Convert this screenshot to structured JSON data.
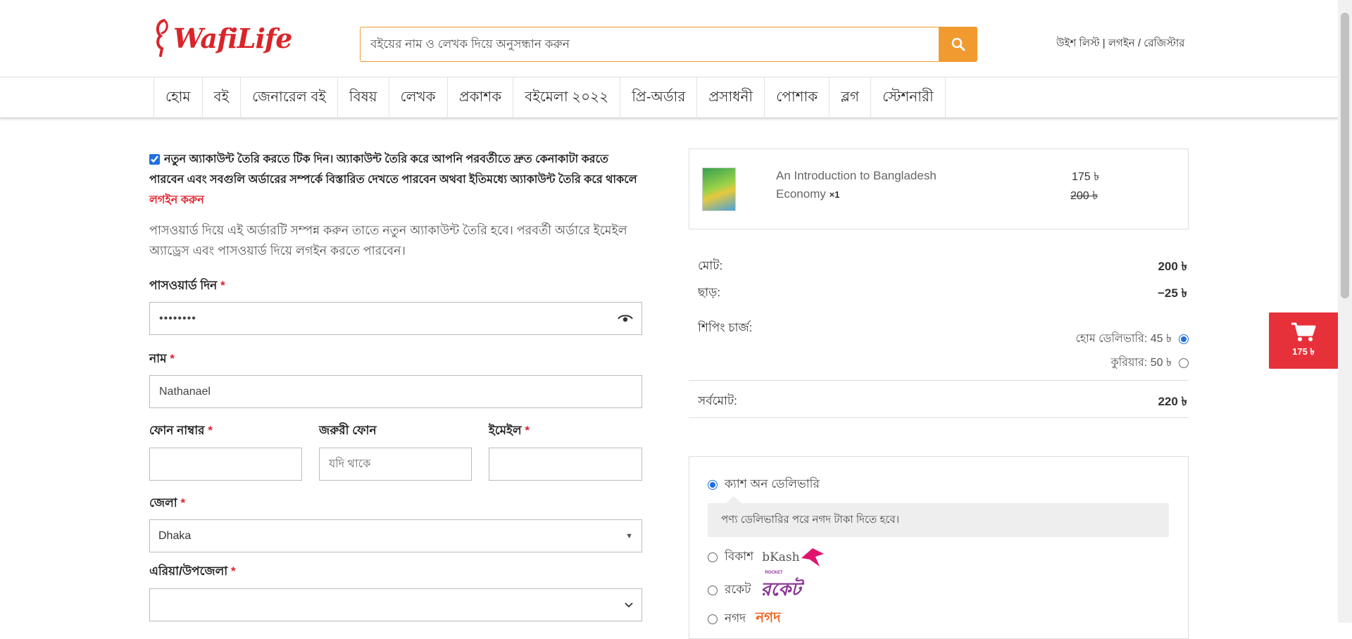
{
  "header": {
    "logo_text": "WafiLife",
    "search_placeholder": "বইয়ের নাম ও লেখক দিয়ে অনুসন্ধান করুন",
    "wishlist": "উইশ লিস্ট",
    "login": "লগইন",
    "register": "রেজিস্টার"
  },
  "nav": [
    "হোম",
    "বই",
    "জেনারেল বই",
    "বিষয়",
    "লেখক",
    "প্রকাশক",
    "বইমেলা ২০২২",
    "প্রি-অর্ডার",
    "প্রসাধনী",
    "পোশাক",
    "ব্লগ",
    "স্টেশনারী"
  ],
  "form": {
    "create_account_checked": true,
    "notice_text": "নতুন অ্যাকাউন্ট তৈরি করতে টিক দিন। অ্যাকাউন্ট তৈরি করে আপনি পরবর্তীতে দ্রুত কেনাকাটা করতে পারবেন এবং সবগুলি অর্ডারের সম্পর্কে বিস্তারিত দেখতে পারবেন অথবা ইতিমধ্যে অ্যাকাউন্ট তৈরি করে থাকলে",
    "login_link": "লগইন করুন",
    "info_text": "পাসওয়ার্ড দিয়ে এই অর্ডারটি সম্পন্ন করুন তাতে নতুন অ্যাকাউন্ট তৈরি হবে। পরবর্তী অর্ডারে ইমেইল অ্যাড্রেস এবং পাসওয়ার্ড দিয়ে লগইন করতে পারবেন।",
    "password_label": "পাসওয়ার্ড দিন",
    "password_value": "••••••••",
    "name_label": "নাম",
    "name_value": "Nathanael",
    "phone_label": "ফোন নাম্বার",
    "alt_phone_label": "জরুরী ফোন",
    "alt_phone_placeholder": "যদি থাকে",
    "email_label": "ইমেইল",
    "district_label": "জেলা",
    "district_value": "Dhaka",
    "area_label": "এরিয়া/উপজেলা",
    "area_value": "",
    "required_mark": "*"
  },
  "order": {
    "product_title": "An Introduction to Bangladesh Economy",
    "product_qty": "×1",
    "price_now": "175 ৳",
    "price_old": "200 ৳",
    "subtotal_label": "মোট:",
    "subtotal_value": "200 ৳",
    "discount_label": "ছাড়:",
    "discount_value": "−25 ৳",
    "shipping_label": "শিপিং চার্জ:",
    "shipping_home": "হোম ডেলিভারি: 45 ৳",
    "shipping_courier": "কুরিয়ার: 50 ৳",
    "total_label": "সর্বমোট:",
    "total_value": "220 ৳"
  },
  "payment": {
    "cod_label": "ক্যাশ অন ডেলিভারি",
    "cod_note": "পণ্য ডেলিভারির পরে নগদ টাকা দিতে হবে।",
    "bkash_label": "বিকাশ",
    "bkash_logo": "bKash",
    "rocket_label": "রকেট",
    "rocket_logo": "রকেট",
    "rocket_logo_small": "ROCKET",
    "nagad_label": "নগদ",
    "nagad_logo": "নগদ"
  },
  "cart": {
    "total": "175 ৳"
  },
  "colors": {
    "brand_red": "#d9252a",
    "accent_orange": "#f19a30",
    "radio_blue": "#1f6fe0"
  }
}
